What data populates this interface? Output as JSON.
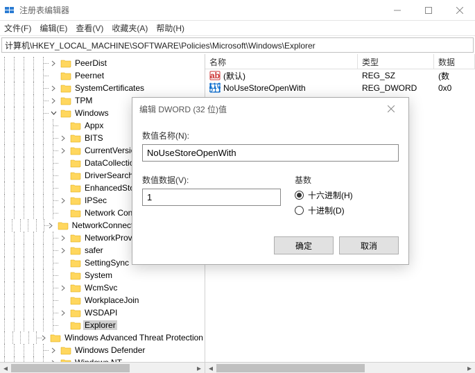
{
  "window": {
    "title": "注册表编辑器"
  },
  "menu": {
    "file": "文件(F)",
    "edit": "编辑(E)",
    "view": "查看(V)",
    "fav": "收藏夹(A)",
    "help": "帮助(H)"
  },
  "address": "计算机\\HKEY_LOCAL_MACHINE\\SOFTWARE\\Policies\\Microsoft\\Windows\\Explorer",
  "tree": [
    {
      "label": "PeerDist",
      "indent": 5,
      "toggle": "closed"
    },
    {
      "label": "Peernet",
      "indent": 5,
      "toggle": "none"
    },
    {
      "label": "SystemCertificates",
      "indent": 5,
      "toggle": "closed"
    },
    {
      "label": "TPM",
      "indent": 5,
      "toggle": "closed"
    },
    {
      "label": "Windows",
      "indent": 5,
      "toggle": "open"
    },
    {
      "label": "Appx",
      "indent": 6,
      "toggle": "none"
    },
    {
      "label": "BITS",
      "indent": 6,
      "toggle": "closed"
    },
    {
      "label": "CurrentVersion",
      "indent": 6,
      "toggle": "closed"
    },
    {
      "label": "DataCollection",
      "indent": 6,
      "toggle": "none"
    },
    {
      "label": "DriverSearching",
      "indent": 6,
      "toggle": "none"
    },
    {
      "label": "EnhancedStorageDevices",
      "indent": 6,
      "toggle": "none"
    },
    {
      "label": "IPSec",
      "indent": 6,
      "toggle": "closed"
    },
    {
      "label": "Network Connections",
      "indent": 6,
      "toggle": "none"
    },
    {
      "label": "NetworkConnectivityStatusIndicator",
      "indent": 6,
      "toggle": "closed"
    },
    {
      "label": "NetworkProvider",
      "indent": 6,
      "toggle": "closed"
    },
    {
      "label": "safer",
      "indent": 6,
      "toggle": "closed"
    },
    {
      "label": "SettingSync",
      "indent": 6,
      "toggle": "none"
    },
    {
      "label": "System",
      "indent": 6,
      "toggle": "none"
    },
    {
      "label": "WcmSvc",
      "indent": 6,
      "toggle": "closed"
    },
    {
      "label": "WorkplaceJoin",
      "indent": 6,
      "toggle": "none"
    },
    {
      "label": "WSDAPI",
      "indent": 6,
      "toggle": "closed"
    },
    {
      "label": "Explorer",
      "indent": 6,
      "toggle": "none",
      "selected": true
    },
    {
      "label": "Windows Advanced Threat Protection",
      "indent": 5,
      "toggle": "closed"
    },
    {
      "label": "Windows Defender",
      "indent": 5,
      "toggle": "closed"
    },
    {
      "label": "Windows NT",
      "indent": 5,
      "toggle": "closed"
    }
  ],
  "list": {
    "cols": {
      "name": "名称",
      "type": "类型",
      "data": "数据"
    },
    "rows": [
      {
        "icon": "string",
        "name": "(默认)",
        "type": "REG_SZ",
        "data": "(数"
      },
      {
        "icon": "binary",
        "name": "NoUseStoreOpenWith",
        "type": "REG_DWORD",
        "data": "0x0"
      }
    ]
  },
  "dialog": {
    "title": "编辑 DWORD (32 位)值",
    "name_label": "数值名称(N):",
    "name_value": "NoUseStoreOpenWith",
    "data_label": "数值数据(V):",
    "data_value": "1",
    "radix_label": "基数",
    "radix_hex": "十六进制(H)",
    "radix_dec": "十进制(D)",
    "ok": "确定",
    "cancel": "取消"
  }
}
